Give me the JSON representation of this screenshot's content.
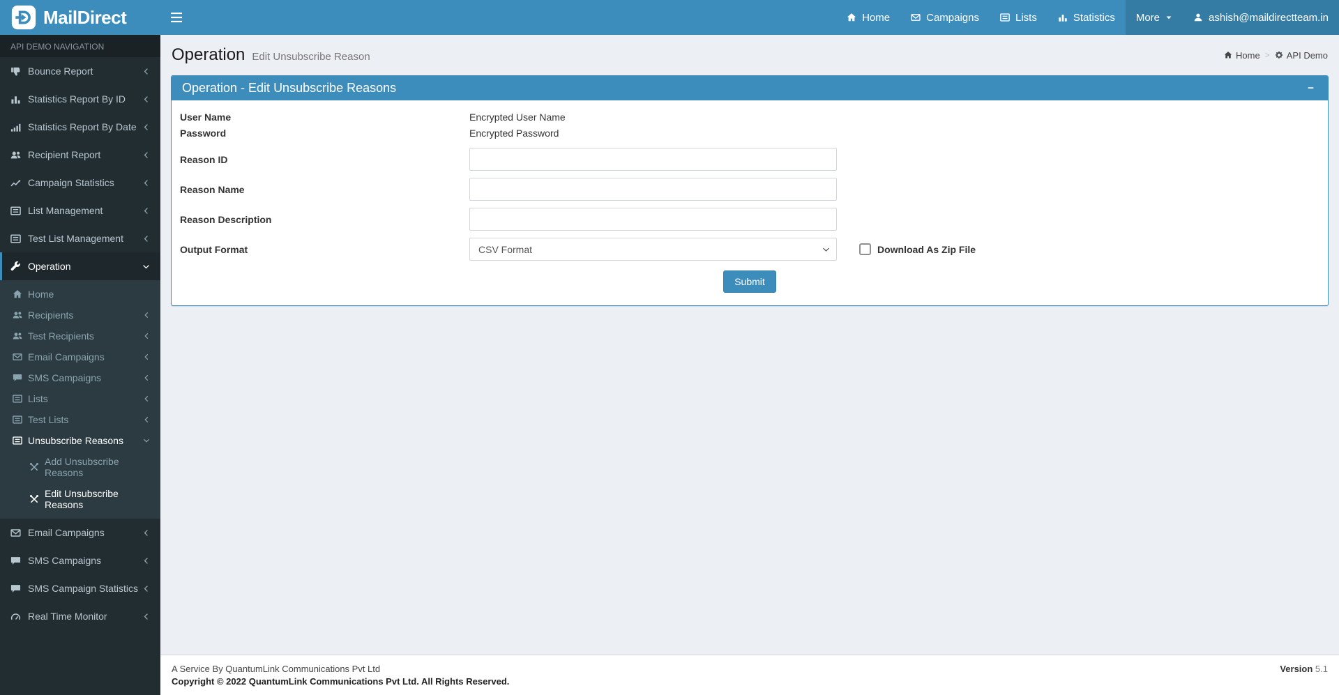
{
  "brand": {
    "name": "MailDirect"
  },
  "navbar": {
    "home": "Home",
    "campaigns": "Campaigns",
    "lists": "Lists",
    "statistics": "Statistics",
    "more": "More",
    "user_email": "ashish@maildirectteam.in"
  },
  "sidebar": {
    "header": "API DEMO NAVIGATION",
    "items": [
      {
        "label": "Bounce Report",
        "icon": "thumbs-down-icon"
      },
      {
        "label": "Statistics Report By ID",
        "icon": "bar-chart-icon"
      },
      {
        "label": "Statistics Report By Date",
        "icon": "signal-icon"
      },
      {
        "label": "Recipient Report",
        "icon": "users-icon"
      },
      {
        "label": "Campaign Statistics",
        "icon": "line-chart-icon"
      },
      {
        "label": "List Management",
        "icon": "list-icon"
      },
      {
        "label": "Test List Management",
        "icon": "list-icon"
      },
      {
        "label": "Operation",
        "icon": "wrench-icon"
      }
    ],
    "operation_children": [
      {
        "label": "Home",
        "icon": "home-icon"
      },
      {
        "label": "Recipients",
        "icon": "users-icon"
      },
      {
        "label": "Test Recipients",
        "icon": "users-icon"
      },
      {
        "label": "Email Campaigns",
        "icon": "envelope-icon"
      },
      {
        "label": "SMS Campaigns",
        "icon": "comment-icon"
      },
      {
        "label": "Lists",
        "icon": "list-icon"
      },
      {
        "label": "Test Lists",
        "icon": "list-icon"
      },
      {
        "label": "Unsubscribe Reasons",
        "icon": "list-icon"
      }
    ],
    "unsubscribe_children": [
      {
        "label": "Add Unsubscribe Reasons",
        "icon": "tools-icon"
      },
      {
        "label": "Edit Unsubscribe Reasons",
        "icon": "tools-icon"
      }
    ],
    "bottom_items": [
      {
        "label": "Email Campaigns",
        "icon": "envelope-icon"
      },
      {
        "label": "SMS Campaigns",
        "icon": "comment-icon"
      },
      {
        "label": "SMS Campaign Statistics",
        "icon": "comment-icon"
      },
      {
        "label": "Real Time Monitor",
        "icon": "gauge-icon"
      }
    ]
  },
  "page": {
    "title": "Operation",
    "subtitle": "Edit Unsubscribe Reason",
    "breadcrumb": {
      "home": "Home",
      "separator": ">",
      "current": "API Demo"
    }
  },
  "panel": {
    "title": "Operation - Edit Unsubscribe Reasons",
    "collapse_glyph": "−"
  },
  "form": {
    "user_name": {
      "label": "User Name",
      "value": "Encrypted User Name"
    },
    "password": {
      "label": "Password",
      "value": "Encrypted Password"
    },
    "reason_id": {
      "label": "Reason ID",
      "value": ""
    },
    "reason_name": {
      "label": "Reason Name",
      "value": ""
    },
    "reason_description": {
      "label": "Reason Description",
      "value": ""
    },
    "output_format": {
      "label": "Output Format",
      "selected": "CSV Format"
    },
    "zip": {
      "label": "Download As Zip File",
      "checked": false
    },
    "submit_label": "Submit"
  },
  "footer": {
    "service": "A Service By QuantumLink Communications Pvt Ltd",
    "copyright": "Copyright © 2022 QuantumLink Communications Pvt Ltd. All Rights Reserved.",
    "version_label": "Version",
    "version_value": "5.1"
  },
  "colors": {
    "navbar": "#3c8dbc",
    "navbar_active": "#357ca5",
    "sidebar_bg": "#222d32",
    "submenu_bg": "#2c3b41",
    "accent": "#3c8dbc",
    "content_bg": "#ecf0f5"
  }
}
